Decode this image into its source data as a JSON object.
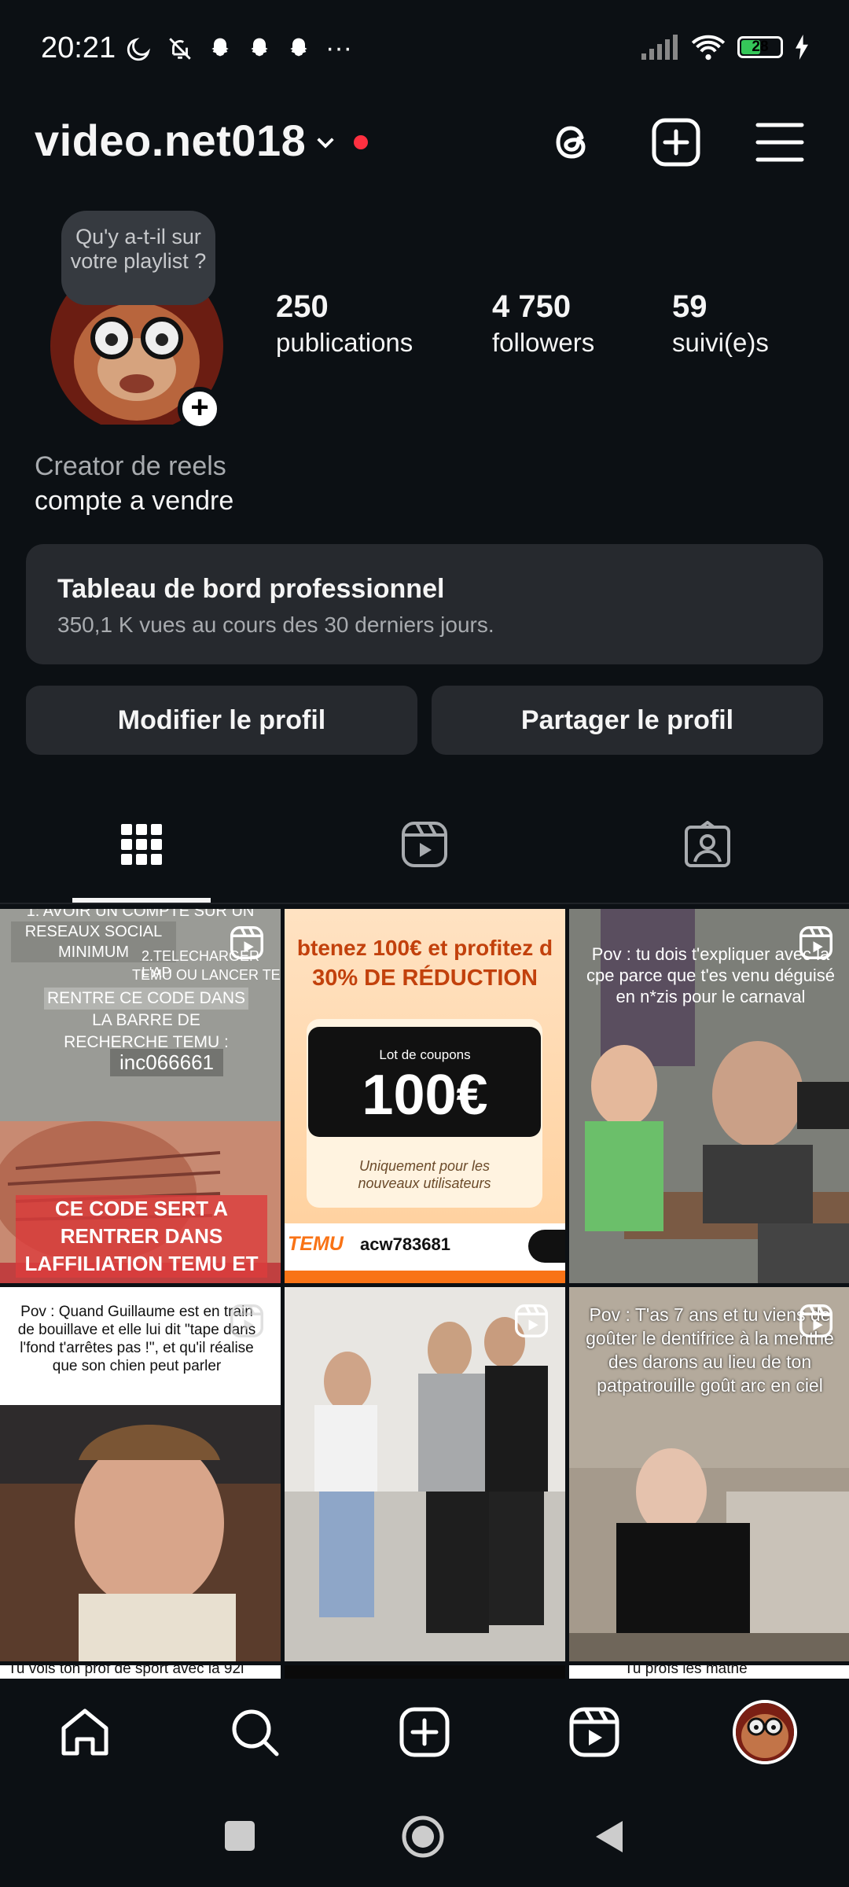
{
  "status_bar": {
    "time": "20:21",
    "battery": "28",
    "more": "···"
  },
  "header": {
    "username": "video.net018"
  },
  "profile": {
    "note": "Qu'y a-t-il sur votre playlist ?",
    "stats": [
      {
        "value": "250",
        "label": "publications"
      },
      {
        "value": "4 750",
        "label": "followers"
      },
      {
        "value": "59",
        "label": "suivi(e)s"
      }
    ],
    "bio_category": "Creator de reels",
    "bio_text": "compte a vendre"
  },
  "dashboard": {
    "title": "Tableau de bord professionnel",
    "subtitle": "350,1 K vues au cours des 30 derniers jours."
  },
  "buttons": {
    "edit": "Modifier le profil",
    "share": "Partager le profil"
  },
  "grid": {
    "post1": {
      "lines": [
        "RESEAUX SOCIAL",
        "MINIMUM",
        "RENTRE CE CODE DANS",
        "LA BARRE DE",
        "RECHERCHE TEMU :"
      ],
      "top_cut": "1: AVOIR UN COMPTE SUR UN",
      "side": "2.TELECHARGER L'AP",
      "side2": "TEMU OU LANCER TE",
      "code": "inc066661",
      "bottom": "CE CODE SERT A RENTRER DANS LAFFILIATION TEMU ET"
    },
    "post2": {
      "headline": "btenez 100€ et profitez d",
      "discount": "30% DE RÉDUCTION",
      "coupon_label": "Lot de coupons",
      "amount": "100€",
      "note": "Uniquement pour les nouveaux utilisateurs",
      "brand": "TEMU",
      "code": "acw783681"
    },
    "post3": {
      "caption": "Pov : tu dois t'expliquer avec la cpe parce que t'es venu déguisé en n*zis pour le carnaval"
    },
    "post4": {
      "caption": "Pov : Quand Guillaume est en train de bouillave et elle lui dit \"tape dans l'fond t'arrêtes pas !\", et qu'il réalise que son chien peut parler"
    },
    "post6": {
      "caption": "Pov : T'as 7 ans et tu viens de goûter le dentifrice à la menthe des darons au lieu de ton patpatrouille goût arc en ciel"
    },
    "row3_cut_1": "Tu vois ton prof de sport avec la 92i",
    "row3_cut_3": "Tu profs les mathé"
  },
  "colors": {
    "background": "#0c1014",
    "card": "#26292e",
    "accent_dot": "#ff3040",
    "temu_orange": "#f97316"
  }
}
